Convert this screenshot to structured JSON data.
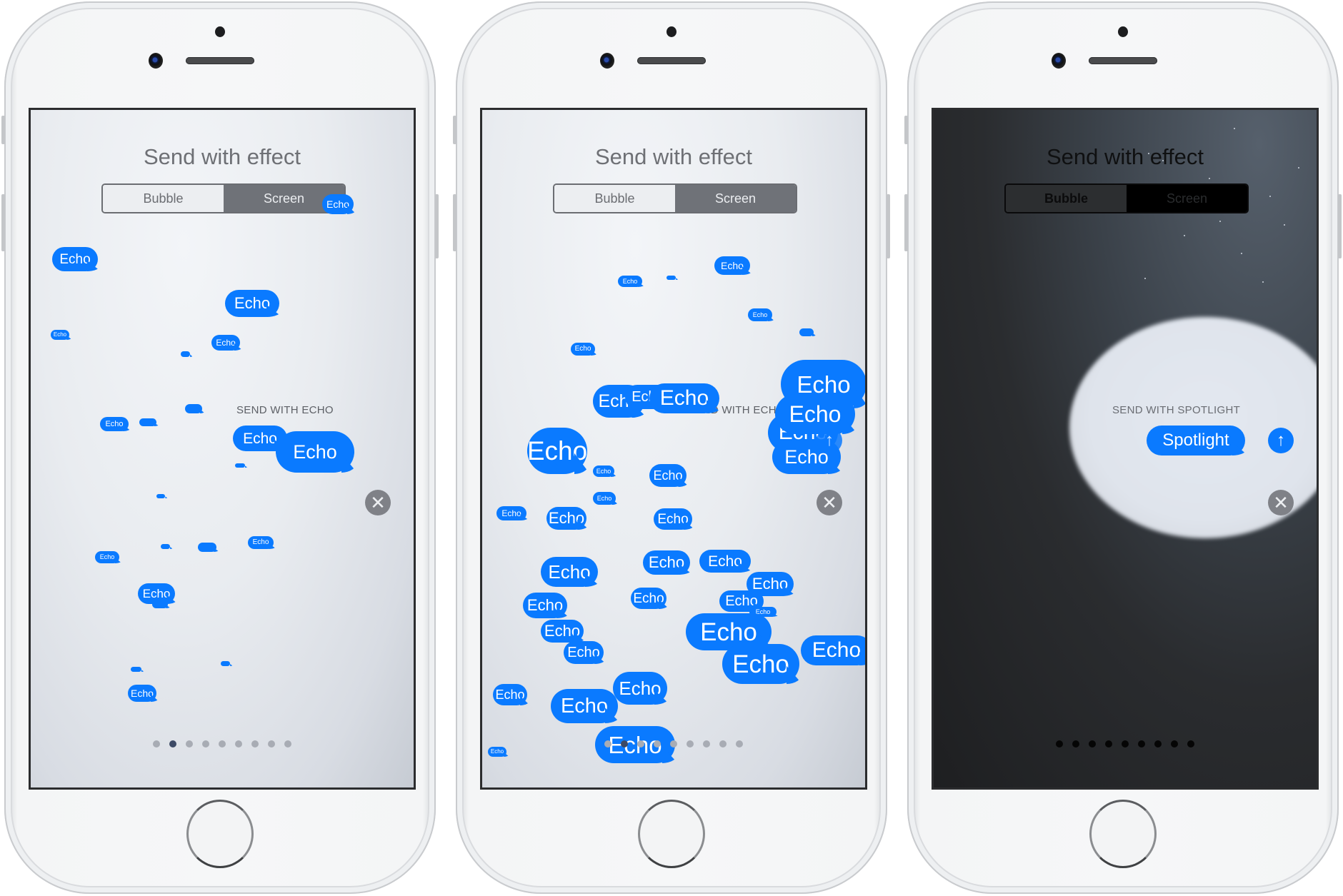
{
  "screens": [
    {
      "title": "Send with effect",
      "segments": [
        "Bubble",
        "Screen"
      ],
      "selected_segment": "Screen",
      "effect_label": "SEND WITH ECHO",
      "bubble_text": "Echo",
      "close_icon": "close-icon",
      "page_dots": 9,
      "active_page": 1,
      "theme": "light"
    },
    {
      "title": "Send with effect",
      "segments": [
        "Bubble",
        "Screen"
      ],
      "selected_segment": "Screen",
      "effect_label": "SEND WITH ECHO",
      "bubble_text": "Echo",
      "close_icon": "close-icon",
      "send_icon": "arrow-up-icon",
      "page_dots": 9,
      "active_page": 1,
      "theme": "light"
    },
    {
      "title": "Send with effect",
      "segments": [
        "Bubble",
        "Screen"
      ],
      "selected_segment": "Screen",
      "effect_label": "SEND WITH SPOTLIGHT",
      "bubble_text": "Spotlight",
      "send_icon": "arrow-up-icon",
      "close_icon": "close-icon",
      "page_dots": 9,
      "active_page": 0,
      "theme": "dark"
    }
  ],
  "colors": {
    "imessage_blue": "#0a7aff",
    "close_gray": "#7f8187",
    "title_gray": "#6e7075",
    "active_dot": "#3d4a66"
  },
  "icons": {
    "close": "✕",
    "send": "↑"
  }
}
